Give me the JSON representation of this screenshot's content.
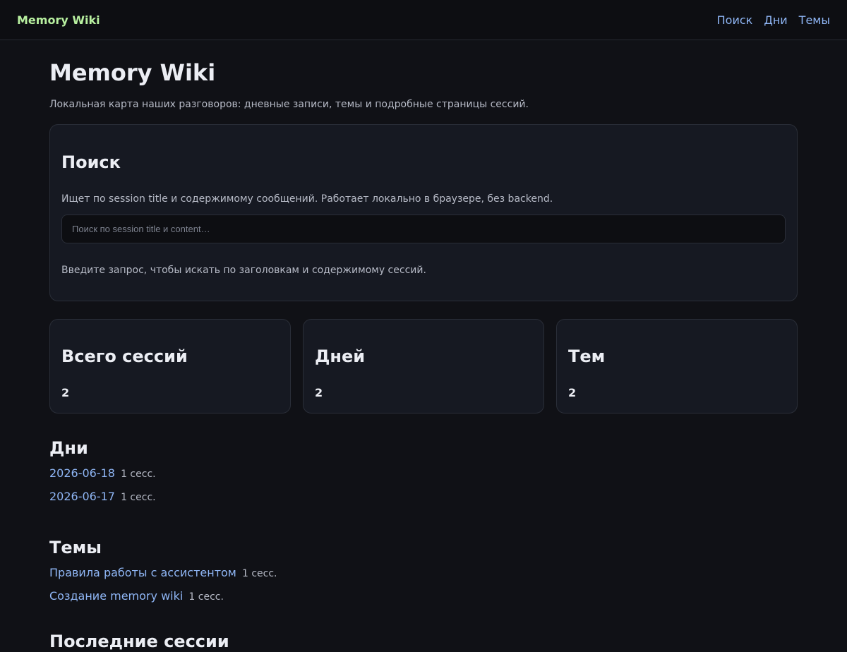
{
  "header": {
    "brand": "Memory Wiki",
    "nav": [
      {
        "label": "Поиск"
      },
      {
        "label": "Дни"
      },
      {
        "label": "Темы"
      }
    ]
  },
  "page": {
    "title": "Memory Wiki",
    "lead": "Локальная карта наших разговоров: дневные записи, темы и подробные страницы сессий."
  },
  "search": {
    "title": "Поиск",
    "description": "Ищет по session title и содержимому сообщений. Работает локально в браузере, без backend.",
    "placeholder": "Поиск по session title и content…",
    "value": "",
    "hint": "Введите запрос, чтобы искать по заголовкам и содержимому сессий."
  },
  "stats": [
    {
      "label": "Всего сессий",
      "value": "2"
    },
    {
      "label": "Дней",
      "value": "2"
    },
    {
      "label": "Тем",
      "value": "2"
    }
  ],
  "days": {
    "title": "Дни",
    "items": [
      {
        "label": "2026-06-18",
        "count": "1 сесс."
      },
      {
        "label": "2026-06-17",
        "count": "1 сесс."
      }
    ]
  },
  "topics": {
    "title": "Темы",
    "items": [
      {
        "label": "Правила работы с ассистентом",
        "count": "1 сесс."
      },
      {
        "label": "Создание memory wiki",
        "count": "1 сесс."
      }
    ]
  },
  "recent": {
    "title": "Последние сессии"
  },
  "colors": {
    "background": "#101116",
    "brand": "#b8f0a0",
    "link": "#8fb6f5",
    "card": "#161922"
  }
}
